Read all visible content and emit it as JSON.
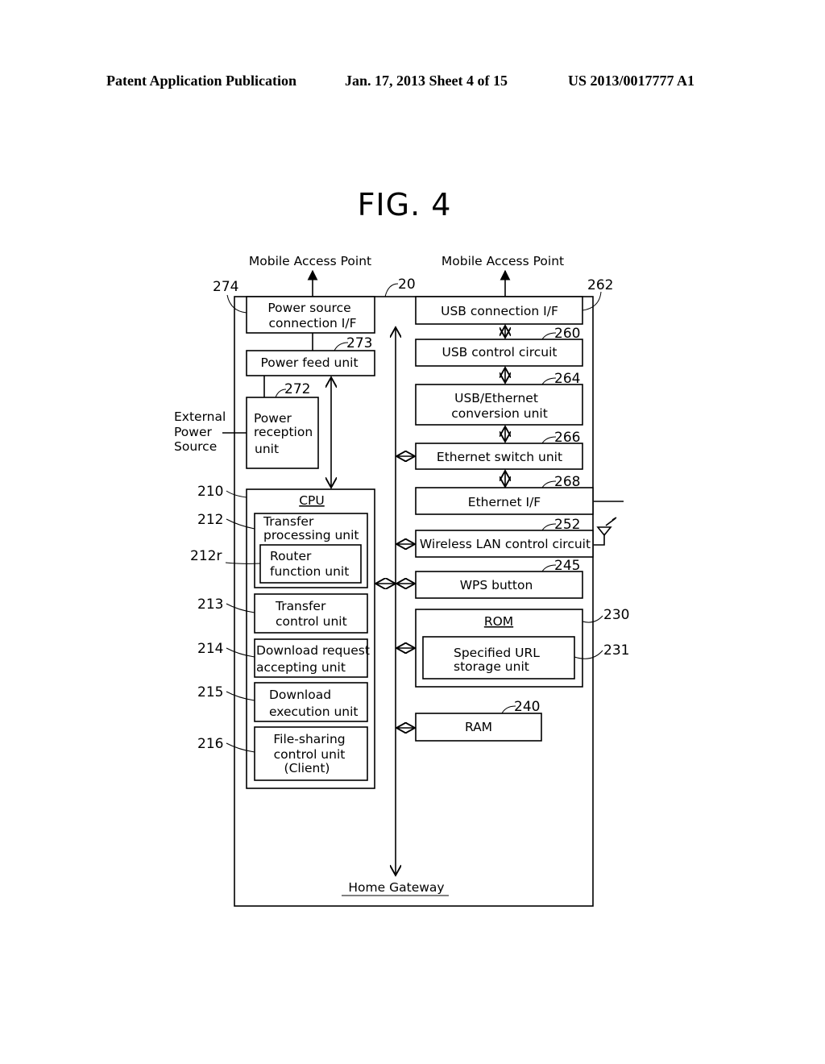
{
  "header": {
    "left": "Patent Application Publication",
    "date_sheet": "Jan. 17, 2013  Sheet 4 of 15",
    "number": "US 2013/0017777 A1"
  },
  "figure_title": "FIG. 4",
  "external_labels": {
    "mobile_ap_left": "Mobile Access Point",
    "mobile_ap_right": "Mobile Access Point",
    "external_power_1": "External",
    "external_power_2": "Power",
    "external_power_3": "Source",
    "home_gateway": "Home Gateway"
  },
  "refs": {
    "device": "20",
    "power_source_if": "274",
    "power_feed": "273",
    "power_reception": "272",
    "usb_if": "262",
    "usb_ctrl": "260",
    "usb_eth": "264",
    "eth_switch": "266",
    "eth_if": "268",
    "wlan": "252",
    "wps": "245",
    "rom": "230",
    "url_storage": "231",
    "ram": "240",
    "cpu": "210",
    "transfer_processing": "212",
    "router": "212r",
    "transfer_control": "213",
    "download_request": "214",
    "download_execution": "215",
    "file_sharing": "216"
  },
  "blocks": {
    "power_source_if": [
      "Power source",
      "connection I/F"
    ],
    "power_feed": [
      "Power feed unit"
    ],
    "power_reception": [
      "Power",
      "reception",
      "unit"
    ],
    "cpu": "CPU",
    "transfer_processing": [
      "Transfer",
      "processing unit"
    ],
    "router": [
      "Router",
      "function unit"
    ],
    "transfer_control": [
      "Transfer",
      "control unit"
    ],
    "download_request": [
      "Download request",
      "accepting unit"
    ],
    "download_execution": [
      "Download",
      "execution unit"
    ],
    "file_sharing": [
      "File-sharing",
      "control unit",
      "(Client)"
    ],
    "usb_if": [
      "USB connection I/F"
    ],
    "usb_ctrl": [
      "USB control circuit"
    ],
    "usb_eth": [
      "USB/Ethernet",
      "conversion unit"
    ],
    "eth_switch": [
      "Ethernet switch unit"
    ],
    "eth_if": [
      "Ethernet I/F"
    ],
    "wlan": [
      "Wireless LAN control circuit"
    ],
    "wps": [
      "WPS button"
    ],
    "rom": "ROM",
    "url_storage": [
      "Specified URL",
      "storage unit"
    ],
    "ram": [
      "RAM"
    ]
  }
}
